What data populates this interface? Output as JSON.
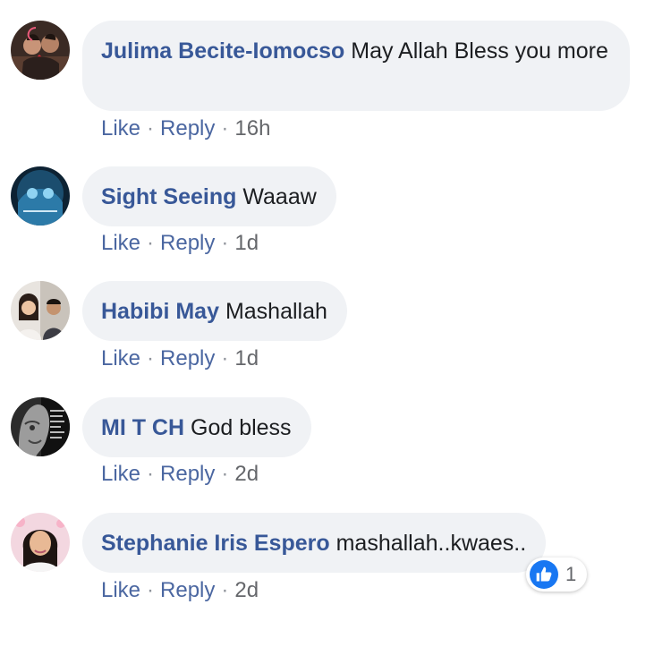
{
  "comments": [
    {
      "author": "Julima Becite-Iomocso",
      "text": "May Allah Bless you more",
      "like_label": "Like",
      "reply_label": "Reply",
      "time": "16h"
    },
    {
      "author": "Sight Seeing",
      "text": "Waaaw",
      "like_label": "Like",
      "reply_label": "Reply",
      "time": "1d"
    },
    {
      "author": "Habibi May",
      "text": "Mashallah",
      "like_label": "Like",
      "reply_label": "Reply",
      "time": "1d"
    },
    {
      "author": "MI T CH",
      "text": "God bless",
      "like_label": "Like",
      "reply_label": "Reply",
      "time": "2d"
    },
    {
      "author": "Stephanie Iris Espero",
      "text": "mashallah..kwaes..",
      "like_label": "Like",
      "reply_label": "Reply",
      "time": "2d",
      "reaction": {
        "icon": "thumbs-up-icon",
        "count": "1"
      }
    }
  ],
  "separator": "·",
  "colors": {
    "author": "#385898",
    "link": "#4b67a1",
    "bubble": "#f0f2f5",
    "like_blue": "#1877f2"
  }
}
